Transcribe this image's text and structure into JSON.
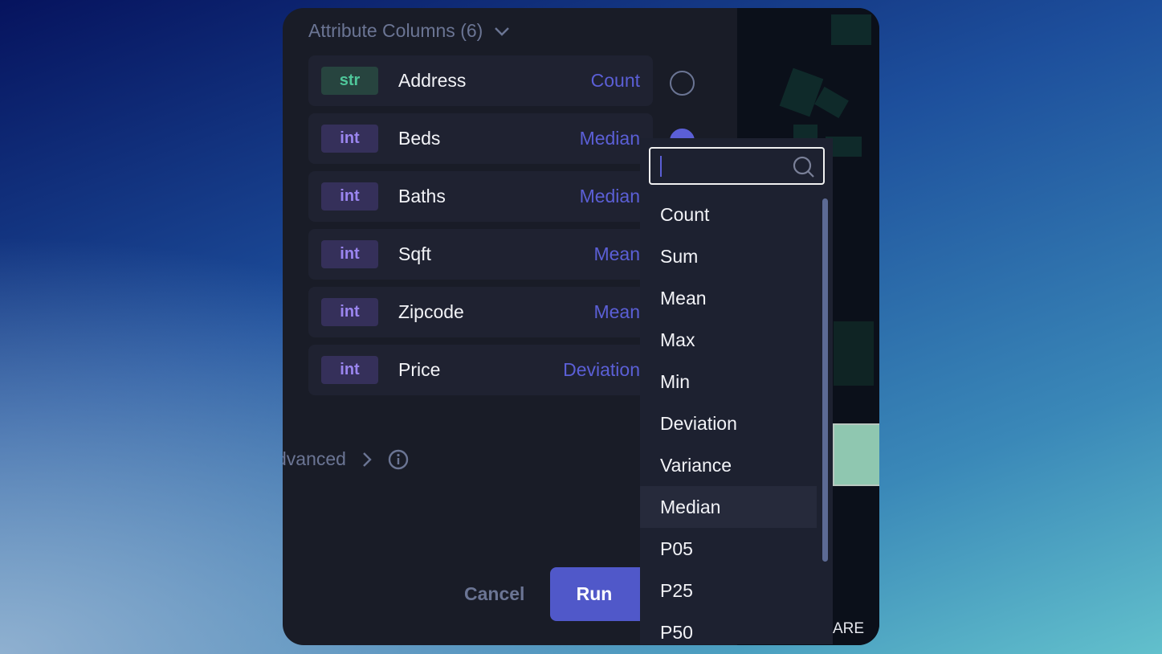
{
  "header": {
    "title": "Attribute Columns (6)"
  },
  "columns": [
    {
      "type": "str",
      "name": "Address",
      "aggregation": "Count",
      "selected": false
    },
    {
      "type": "int",
      "name": "Beds",
      "aggregation": "Median",
      "selected": true
    },
    {
      "type": "int",
      "name": "Baths",
      "aggregation": "Median",
      "selected": false
    },
    {
      "type": "int",
      "name": "Sqft",
      "aggregation": "Mean",
      "selected": false
    },
    {
      "type": "int",
      "name": "Zipcode",
      "aggregation": "Mean",
      "selected": false
    },
    {
      "type": "int",
      "name": "Price",
      "aggregation": "Deviation",
      "selected": false
    }
  ],
  "advanced": {
    "label": "dvanced"
  },
  "footer": {
    "cancel": "Cancel",
    "run": "Run"
  },
  "map": {
    "label": "ARE"
  },
  "dropdown": {
    "search_value": "",
    "options": [
      "Count",
      "Sum",
      "Mean",
      "Max",
      "Min",
      "Deviation",
      "Variance",
      "Median",
      "P05",
      "P25",
      "P50"
    ],
    "highlighted": "Median"
  },
  "colors": {
    "accent": "#5b5fd6",
    "str_badge": "#4fc79a",
    "int_badge": "#9b86f0"
  }
}
